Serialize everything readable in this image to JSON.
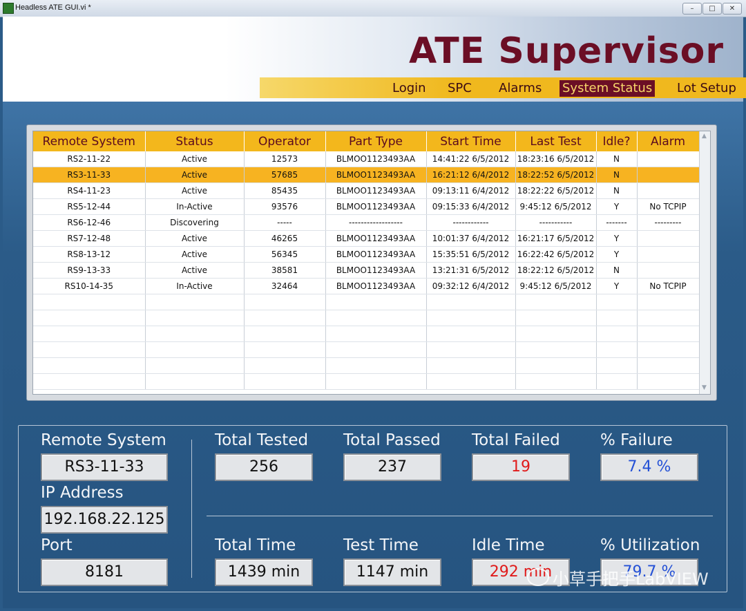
{
  "window": {
    "title": "Headless ATE GUI.vi *",
    "minimize": "–",
    "maximize": "□",
    "close": "✕"
  },
  "header": {
    "title": "ATE Supervisor"
  },
  "nav": {
    "items": [
      {
        "label": "Login"
      },
      {
        "label": "SPC"
      },
      {
        "label": "Alarms"
      },
      {
        "label": "System Status",
        "active": true
      },
      {
        "label": "Lot Setup"
      }
    ]
  },
  "table": {
    "columns": [
      "Remote System",
      "Status",
      "Operator",
      "Part Type",
      "Start Time",
      "Last Test",
      "Idle?",
      "Alarm"
    ],
    "rows": [
      [
        "RS2-11-22",
        "Active",
        "12573",
        "BLMOO1123493AA",
        "14:41:22  6/5/2012",
        "18:23:16  6/5/2012",
        "N",
        ""
      ],
      [
        "RS3-11-33",
        "Active",
        "57685",
        "BLMOO1123493AA",
        "16:21:12  6/4/2012",
        "18:22:52  6/5/2012",
        "N",
        ""
      ],
      [
        "RS4-11-23",
        "Active",
        "85435",
        "BLMOO1123493AA",
        "09:13:11  6/4/2012",
        "18:22:22  6/5/2012",
        "N",
        ""
      ],
      [
        "RS5-12-44",
        "In-Active",
        "93576",
        "BLMOO1123493AA",
        "09:15:33  6/4/2012",
        "9:45:12  6/5/2012",
        "Y",
        "No TCPIP"
      ],
      [
        "RS6-12-46",
        "Discovering",
        "-----",
        "------------------",
        "------------",
        "-----------",
        "-------",
        "---------"
      ],
      [
        "RS7-12-48",
        "Active",
        "46265",
        "BLMOO1123493AA",
        "10:01:37  6/4/2012",
        "16:21:17  6/5/2012",
        "Y",
        ""
      ],
      [
        "RS8-13-12",
        "Active",
        "56345",
        "BLMOO1123493AA",
        "15:35:51  6/5/2012",
        "16:22:42  6/5/2012",
        "Y",
        ""
      ],
      [
        "RS9-13-33",
        "Active",
        "38581",
        "BLMOO1123493AA",
        "13:21:31  6/5/2012",
        "18:22:12  6/5/2012",
        "N",
        ""
      ],
      [
        "RS10-14-35",
        "In-Active",
        "32464",
        "BLMOO1123493AA",
        "09:32:12  6/4/2012",
        "9:45:12  6/5/2012",
        "Y",
        "No TCPIP"
      ]
    ],
    "selected_row": 1,
    "empty_rows": 6
  },
  "stats": {
    "remote_system": {
      "label": "Remote System",
      "value": "RS3-11-33"
    },
    "ip_address": {
      "label": "IP Address",
      "value": "192.168.22.125"
    },
    "port": {
      "label": "Port",
      "value": "8181"
    },
    "total_tested": {
      "label": "Total Tested",
      "value": "256"
    },
    "total_passed": {
      "label": "Total Passed",
      "value": "237"
    },
    "total_failed": {
      "label": "Total Failed",
      "value": "19"
    },
    "pct_failure": {
      "label": "% Failure",
      "value": "7.4 %"
    },
    "total_time": {
      "label": "Total Time",
      "value": "1439 min"
    },
    "test_time": {
      "label": "Test Time",
      "value": "1147 min"
    },
    "idle_time": {
      "label": "Idle Time",
      "value": "292 min"
    },
    "pct_utilization": {
      "label": "% Utilization",
      "value": "79.7 %"
    }
  },
  "watermark": {
    "text": "小草手把手LabVIEW"
  },
  "colors": {
    "accent": "#f3b71c",
    "brand": "#6b0e25",
    "background": "#2b5b88",
    "alert": "#e01a1a",
    "info": "#2451d6"
  }
}
